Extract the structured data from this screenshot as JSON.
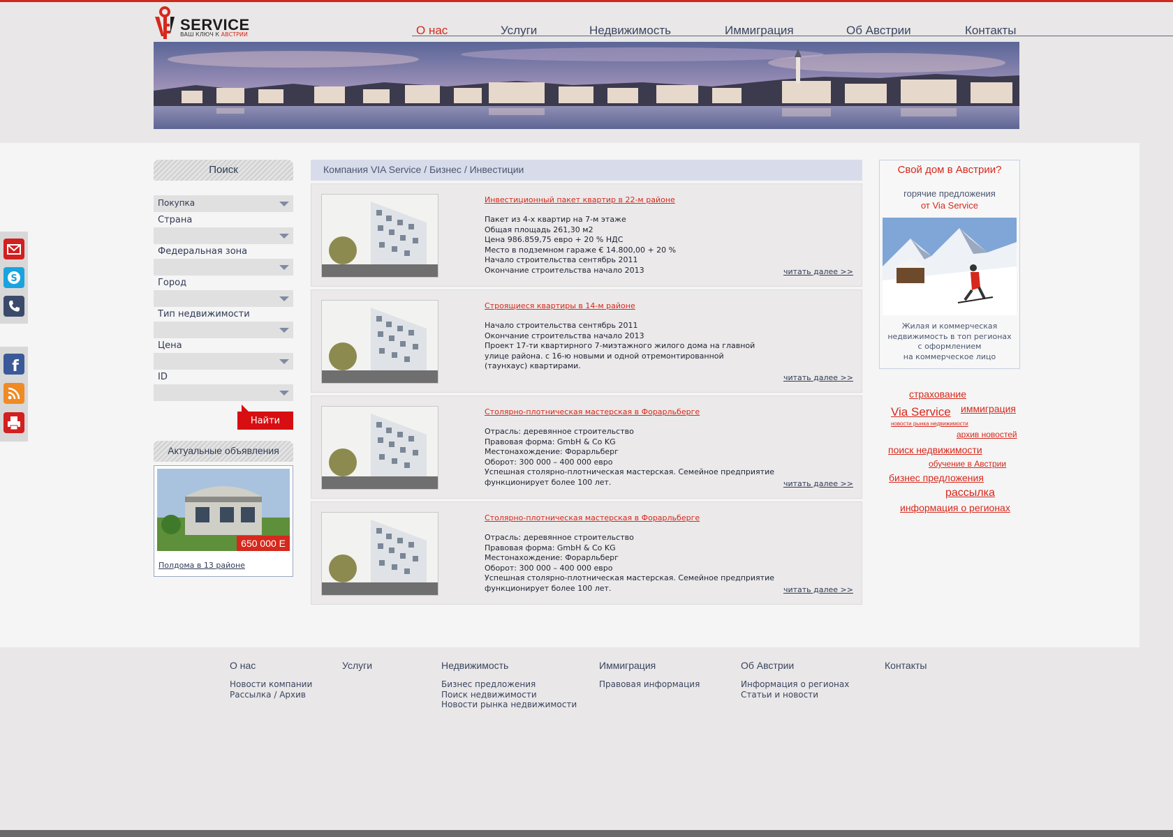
{
  "header": {
    "logo_text": "SERVICE",
    "logo_sub_prefix": "ВАШ КЛЮЧ К",
    "logo_sub_accent": "АВСТРИИ",
    "nav": [
      "О нас",
      "Услуги",
      "Недвижимость",
      "Иммиграция",
      "Об Австрии",
      "Контакты"
    ],
    "active_nav": "О нас"
  },
  "social": {
    "group1": [
      "mail-icon",
      "skype-icon",
      "phone-icon"
    ],
    "group2": [
      "facebook-icon",
      "rss-icon",
      "print-icon"
    ]
  },
  "search": {
    "title": "Поиск",
    "deal_type": "Покупка",
    "labels": [
      "Страна",
      "Федеральная зона",
      "Город",
      "Тип недвижимости",
      "Цена",
      "ID"
    ],
    "button": "Найти"
  },
  "ads": {
    "title": "Актуальные объявления",
    "price": "650 000 Е",
    "link": "Полдома в 13 районе"
  },
  "breadcrumb": "Компания VIA Service / Бизнес / Инвестиции",
  "items": [
    {
      "title": "Инвестиционный пакет квартир в 22-м районе",
      "lines": [
        "Пакет из 4-х квартир на 7-м этаже",
        "Общая площадь 261,30 м2",
        "Цена 986.859,75 евро + 20 % НДС",
        "Место в подземном гараже € 14.800,00 + 20 %",
        "Начало строительства сентябрь 2011",
        "Окончание строительства начало 2013"
      ],
      "more": "читать далее >>"
    },
    {
      "title": "Строящиеся квартиры в 14-м районе",
      "lines": [
        "Начало строительства сентябрь 2011",
        "Окончание строительства начало 2013",
        "Проект 17-ти квартирного 7-миэтажного жилого дома на главной улице района. с 16-ю новыми и одной отремонтированной (таунхаус) квартирами."
      ],
      "more": "читать далее >>"
    },
    {
      "title": "Столярно-плотническая мастерская в Форарльберге",
      "lines": [
        "Отрасль: деревянное строительство",
        "Правовая форма: GmbH & Co KG",
        "Местонахождение: Форарльберг",
        "Оборот: 300 000 – 400 000 евро",
        "Успешная столярно-плотническая мастерская. Семейное предприятие функционирует более 100 лет."
      ],
      "more": "читать далее >>"
    },
    {
      "title": "Столярно-плотническая мастерская в Форарльберге",
      "lines": [
        "Отрасль: деревянное строительство",
        "Правовая форма: GmbH & Co KG",
        "Местонахождение: Форарльберг",
        "Оборот: 300 000 – 400 000 евро",
        "Успешная столярно-плотническая мастерская. Семейное предприятие функционирует более 100 лет."
      ],
      "more": "читать далее >>"
    }
  ],
  "promo": {
    "title": "Свой дом в Австрии?",
    "sub1": "горячие предложения",
    "sub2": "от Via Service",
    "text": [
      "Жилая и коммерческая",
      "недвижимость в топ регионах",
      "с оформлением",
      "на коммерческое лицо"
    ]
  },
  "tags": [
    "страхование",
    "Via Service",
    "иммиграция",
    "новости рынка недвижимости",
    "архив новостей",
    "поиск недвижимости",
    "обучение в Австрии",
    "бизнес предложения",
    "рассылка",
    "информация о регионах"
  ],
  "footer": [
    {
      "head": "О нас",
      "links": [
        "Новости компании",
        "Рассылка / Архив"
      ]
    },
    {
      "head": "Услуги",
      "links": []
    },
    {
      "head": "Недвижимость",
      "links": [
        "Бизнес предложения",
        "Поиск недвижимости",
        "Новости рынка недвижимости"
      ]
    },
    {
      "head": "Иммиграция",
      "links": [
        "Правовая информация"
      ]
    },
    {
      "head": "Об Австрии",
      "links": [
        "Информация о регионах",
        "Статьи и новости"
      ]
    },
    {
      "head": "Контакты",
      "links": []
    }
  ],
  "colors": {
    "accent": "#d6281c",
    "text": "#3a4560",
    "page_bg": "#e9e7e7"
  }
}
